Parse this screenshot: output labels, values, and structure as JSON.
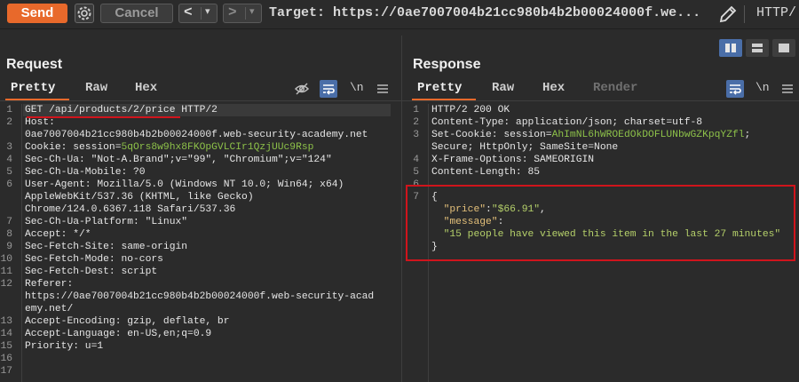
{
  "toolbar": {
    "send_label": "Send",
    "cancel_label": "Cancel",
    "back_label": "<",
    "forward_label": ">",
    "dropdown_glyph": "▾",
    "target_text": "Target: https://0ae7007004b21cc980b4b2b00024000f.we...",
    "protocol_text": "HTTP/"
  },
  "request": {
    "title": "Request",
    "tabs": [
      "Pretty",
      "Raw",
      "Hex"
    ],
    "newline_label": "\\n",
    "line_numbers": [
      "1",
      "2",
      "",
      "3",
      "4",
      "5",
      "6",
      "",
      "",
      "7",
      "8",
      "9",
      "10",
      "11",
      "12",
      "",
      "",
      "13",
      "14",
      "15",
      "16",
      "17"
    ],
    "lines": [
      {
        "parts": [
          {
            "t": "GET /api/products/2/price HTTP/2",
            "c": "k"
          }
        ]
      },
      {
        "parts": [
          {
            "t": "Host: ",
            "c": "k"
          }
        ]
      },
      {
        "parts": [
          {
            "t": "0ae7007004b21cc980b4b2b00024000f.web-security-academy.net",
            "c": "v"
          }
        ]
      },
      {
        "parts": [
          {
            "t": "Cookie: session=",
            "c": "k"
          },
          {
            "t": "5qOrs8w9hx8FKOpGVLCIr1QzjUUc9Rsp",
            "c": "green"
          }
        ]
      },
      {
        "parts": [
          {
            "t": "Sec-Ch-Ua: \"Not-A.Brand\";v=\"99\", \"Chromium\";v=\"124\"",
            "c": "k"
          }
        ]
      },
      {
        "parts": [
          {
            "t": "Sec-Ch-Ua-Mobile: ?0",
            "c": "k"
          }
        ]
      },
      {
        "parts": [
          {
            "t": "User-Agent: Mozilla/5.0 (Windows NT 10.0; Win64; x64)",
            "c": "k"
          }
        ]
      },
      {
        "parts": [
          {
            "t": "AppleWebKit/537.36 (KHTML, like Gecko)",
            "c": "v"
          }
        ]
      },
      {
        "parts": [
          {
            "t": "Chrome/124.0.6367.118 Safari/537.36",
            "c": "v"
          }
        ]
      },
      {
        "parts": [
          {
            "t": "Sec-Ch-Ua-Platform: \"Linux\"",
            "c": "k"
          }
        ]
      },
      {
        "parts": [
          {
            "t": "Accept: */*",
            "c": "k"
          }
        ]
      },
      {
        "parts": [
          {
            "t": "Sec-Fetch-Site: same-origin",
            "c": "k"
          }
        ]
      },
      {
        "parts": [
          {
            "t": "Sec-Fetch-Mode: no-cors",
            "c": "k"
          }
        ]
      },
      {
        "parts": [
          {
            "t": "Sec-Fetch-Dest: script",
            "c": "k"
          }
        ]
      },
      {
        "parts": [
          {
            "t": "Referer:",
            "c": "k"
          }
        ]
      },
      {
        "parts": [
          {
            "t": "https://0ae7007004b21cc980b4b2b00024000f.web-security-acad",
            "c": "v"
          }
        ]
      },
      {
        "parts": [
          {
            "t": "emy.net/",
            "c": "v"
          }
        ]
      },
      {
        "parts": [
          {
            "t": "Accept-Encoding: gzip, deflate, br",
            "c": "k"
          }
        ]
      },
      {
        "parts": [
          {
            "t": "Accept-Language: en-US,en;q=0.9",
            "c": "k"
          }
        ]
      },
      {
        "parts": [
          {
            "t": "Priority: u=1",
            "c": "k"
          }
        ]
      },
      {
        "parts": [
          {
            "t": "",
            "c": "k"
          }
        ]
      },
      {
        "parts": [
          {
            "t": "",
            "c": "k"
          }
        ]
      }
    ]
  },
  "response": {
    "title": "Response",
    "tabs": [
      "Pretty",
      "Raw",
      "Hex",
      "Render"
    ],
    "newline_label": "\\n",
    "line_numbers": [
      "1",
      "2",
      "3",
      "",
      "4",
      "5",
      "6",
      "7",
      "",
      "",
      ""
    ],
    "lines": [
      {
        "parts": [
          {
            "t": "HTTP/2 200 OK",
            "c": "k"
          }
        ]
      },
      {
        "parts": [
          {
            "t": "Content-Type: application/json; charset=utf-8",
            "c": "k"
          }
        ]
      },
      {
        "parts": [
          {
            "t": "Set-Cookie: session=",
            "c": "k"
          },
          {
            "t": "AhImNL6hWROEdOkDOFLUNbwGZKpqYZfl",
            "c": "green"
          },
          {
            "t": ";",
            "c": "k"
          }
        ]
      },
      {
        "parts": [
          {
            "t": "Secure; HttpOnly; SameSite=None",
            "c": "v"
          }
        ]
      },
      {
        "parts": [
          {
            "t": "X-Frame-Options: SAMEORIGIN",
            "c": "k"
          }
        ]
      },
      {
        "parts": [
          {
            "t": "Content-Length: 85",
            "c": "k"
          }
        ]
      },
      {
        "parts": [
          {
            "t": "",
            "c": "k"
          }
        ]
      },
      {
        "parts": [
          {
            "t": "{",
            "c": "k"
          }
        ]
      },
      {
        "parts": [
          {
            "t": "  ",
            "c": "k"
          },
          {
            "t": "\"price\"",
            "c": "jkey"
          },
          {
            "t": ":",
            "c": "k"
          },
          {
            "t": "\"$66.91\"",
            "c": "jstr"
          },
          {
            "t": ",",
            "c": "k"
          }
        ]
      },
      {
        "parts": [
          {
            "t": "  ",
            "c": "k"
          },
          {
            "t": "\"message\"",
            "c": "jkey"
          },
          {
            "t": ":",
            "c": "k"
          }
        ]
      },
      {
        "parts": [
          {
            "t": "  ",
            "c": "k"
          },
          {
            "t": "\"15 people have viewed this item in the last 27 minutes\"",
            "c": "jstr"
          }
        ]
      },
      {
        "parts": [
          {
            "t": "}",
            "c": "k"
          }
        ]
      }
    ]
  },
  "colors": {
    "accent": "#e8692b",
    "highlight_box": "#d0141c",
    "active_layout": "#4a6ea8"
  }
}
